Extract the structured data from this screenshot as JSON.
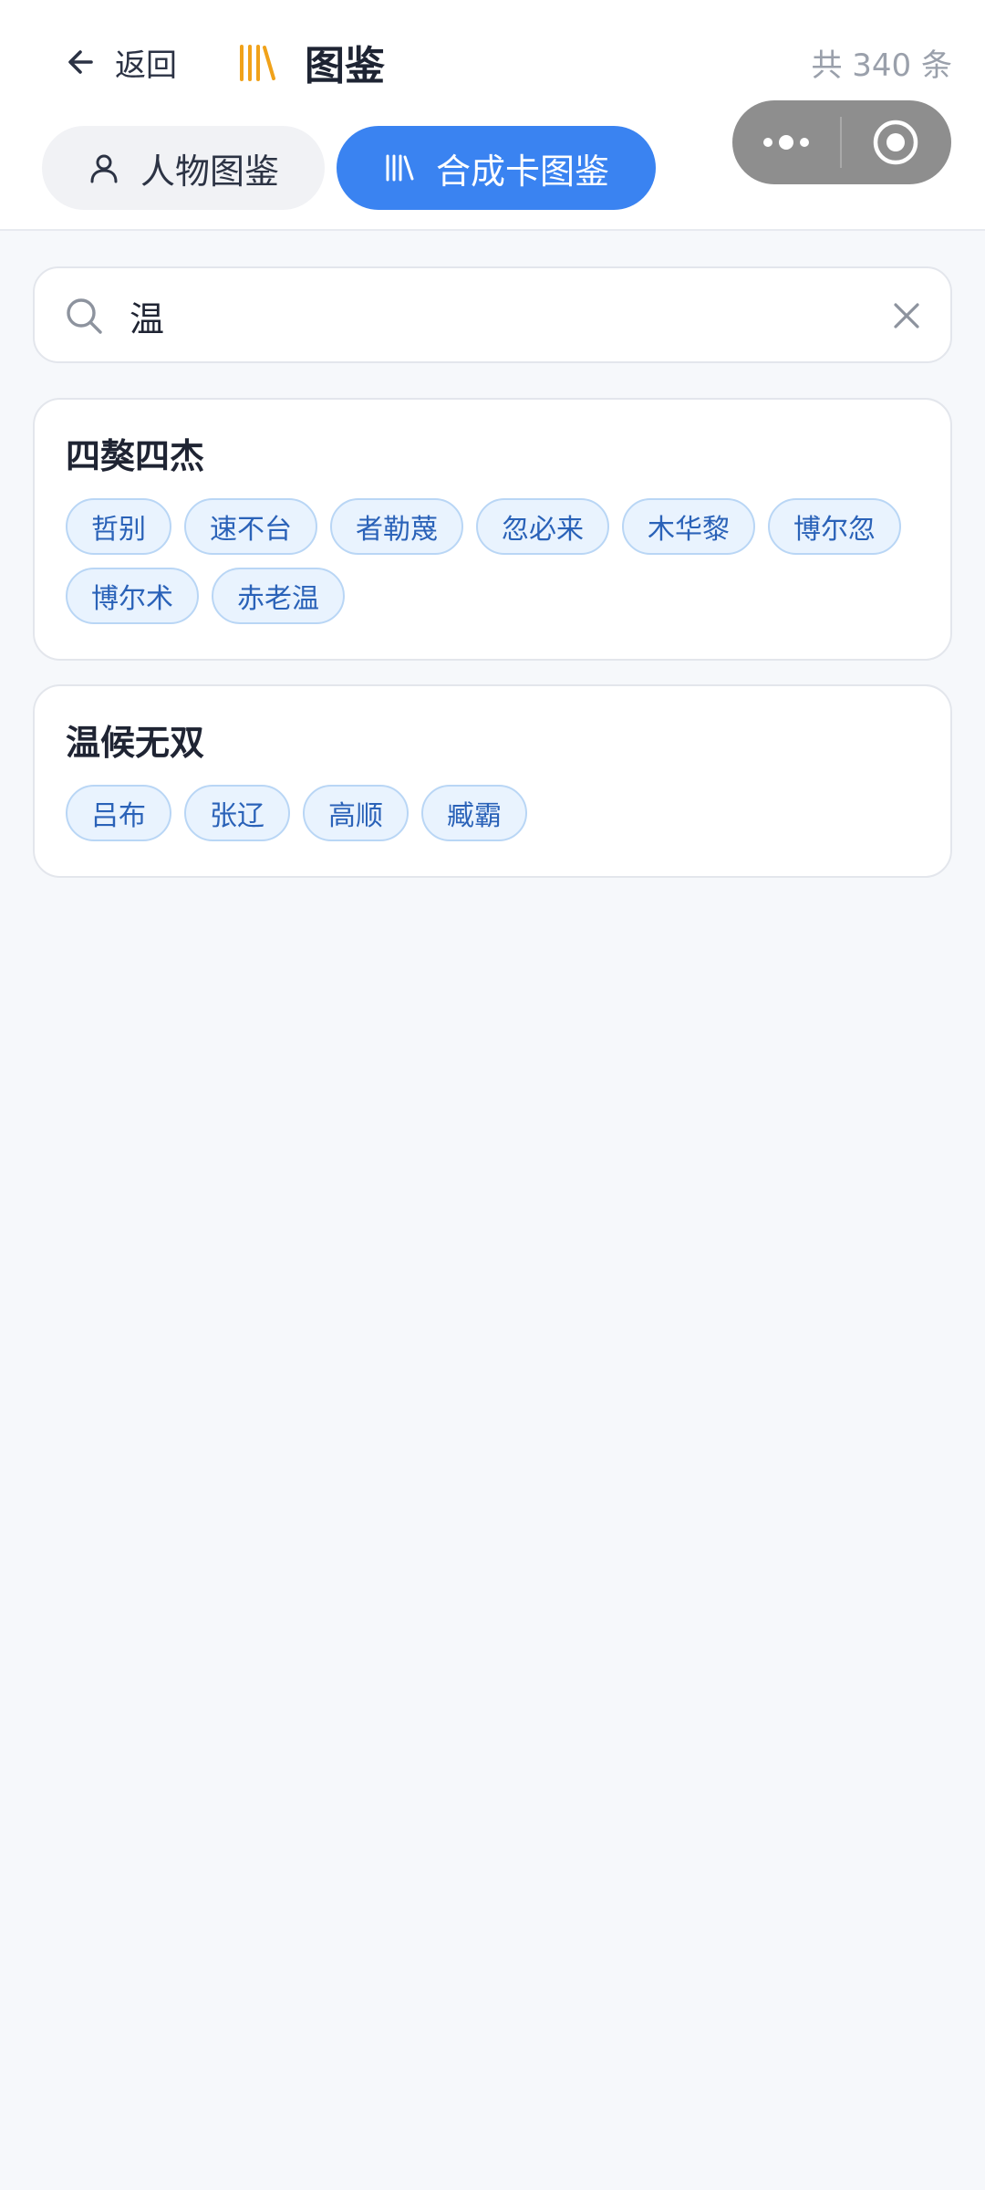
{
  "header": {
    "back_label": "返回",
    "title": "图鉴",
    "total_count": "共 340 条",
    "title_icon_color": "#f0a21a",
    "tabs": [
      {
        "label": "人物图鉴",
        "icon": "person-icon",
        "active": false
      },
      {
        "label": "合成卡图鉴",
        "icon": "books-icon",
        "active": true
      }
    ],
    "active_tab_color": "#3a83f1"
  },
  "search": {
    "value": "温",
    "placeholder": ""
  },
  "results": [
    {
      "title": "四獒四杰",
      "members": [
        "哲别",
        "速不台",
        "者勒蔑",
        "忽必来",
        "木华黎",
        "博尔忽",
        "博尔术",
        "赤老温"
      ]
    },
    {
      "title": "温候无双",
      "members": [
        "吕布",
        "张辽",
        "高顺",
        "臧霸"
      ]
    }
  ]
}
